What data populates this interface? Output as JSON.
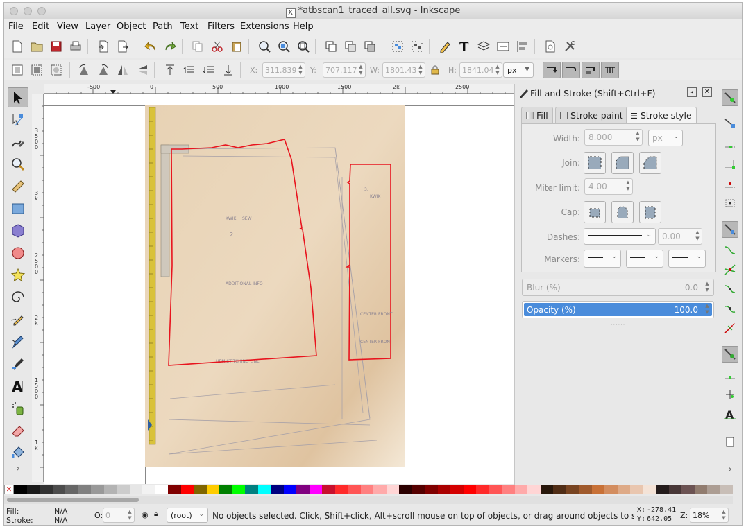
{
  "window": {
    "title": "*atbscan1_traced_all.svg - Inkscape"
  },
  "menu": [
    "File",
    "Edit",
    "View",
    "Layer",
    "Object",
    "Path",
    "Text",
    "Filters",
    "Extensions",
    "Help"
  ],
  "controls": {
    "x_label": "X:",
    "x_value": "311.839",
    "y_label": "Y:",
    "y_value": "707.117",
    "w_label": "W:",
    "w_value": "1801.43",
    "h_label": "H:",
    "h_value": "1841.04",
    "unit": "px"
  },
  "ruler": {
    "h_ticks": [
      "-500",
      "0",
      "500",
      "1000",
      "1500",
      "2k",
      "2500"
    ],
    "v_ticks": [
      "3500",
      "3k",
      "2500",
      "2k",
      "1500",
      "1k"
    ]
  },
  "dialog": {
    "title": "Fill and Stroke (Shift+Ctrl+F)",
    "tabs": [
      "Fill",
      "Stroke paint",
      "Stroke style"
    ],
    "width_label": "Width:",
    "width_value": "8.000",
    "width_unit": "px",
    "join_label": "Join:",
    "miter_label": "Miter limit:",
    "miter_value": "4.00",
    "cap_label": "Cap:",
    "dashes_label": "Dashes:",
    "dashes_value": "0.00",
    "markers_label": "Markers:",
    "blur_label": "Blur (%)",
    "blur_value": "0.0",
    "opacity_label": "Opacity (%)",
    "opacity_value": "100.0",
    "opacity_fraction": 1.0
  },
  "status": {
    "fill_label": "Fill:",
    "fill_value": "N/A",
    "stroke_label": "Stroke:",
    "stroke_value": "N/A",
    "opacity_label": "O:",
    "opacity_value": "0",
    "layer": "(root)",
    "message": "No objects selected. Click, Shift+click, Alt+scroll mouse on top of objects, or drag around objects to s",
    "cursor_x_label": "X:",
    "cursor_x": "-278.41",
    "cursor_y_label": "Y:",
    "cursor_y": "642.05",
    "zoom_label": "Z:",
    "zoom": "18%"
  },
  "colors": {
    "accent": "#4a8cdb",
    "trace": "#e8141e",
    "paper": "#e9d6b8"
  },
  "palette": [
    "#000000",
    "#1a1a1a",
    "#333333",
    "#4d4d4d",
    "#666666",
    "#808080",
    "#999999",
    "#b3b3b3",
    "#cccccc",
    "#e6e6e6",
    "#f2f2f2",
    "#ffffff",
    "#800000",
    "#ff0000",
    "#806600",
    "#ffcc00",
    "#008000",
    "#00ff00",
    "#008080",
    "#00ffff",
    "#000080",
    "#0000ff",
    "#800080",
    "#ff00ff",
    "#c8102e",
    "#ff2a2a",
    "#ff5555",
    "#ff8080",
    "#ffaaaa",
    "#ffd5d5",
    "#2b0000",
    "#550000",
    "#800000",
    "#aa0000",
    "#d40000",
    "#ff0000",
    "#ff2a2a",
    "#ff5555",
    "#ff8080",
    "#ffaaaa",
    "#ffd5d5",
    "#28170b",
    "#502d16",
    "#784421",
    "#a05a2c",
    "#c87137",
    "#d38d5f",
    "#deaa87",
    "#e9c6af",
    "#f4e3d7",
    "#241c1c",
    "#483737",
    "#6c5353",
    "#917c6f",
    "#ac9d93",
    "#c8beb7"
  ]
}
